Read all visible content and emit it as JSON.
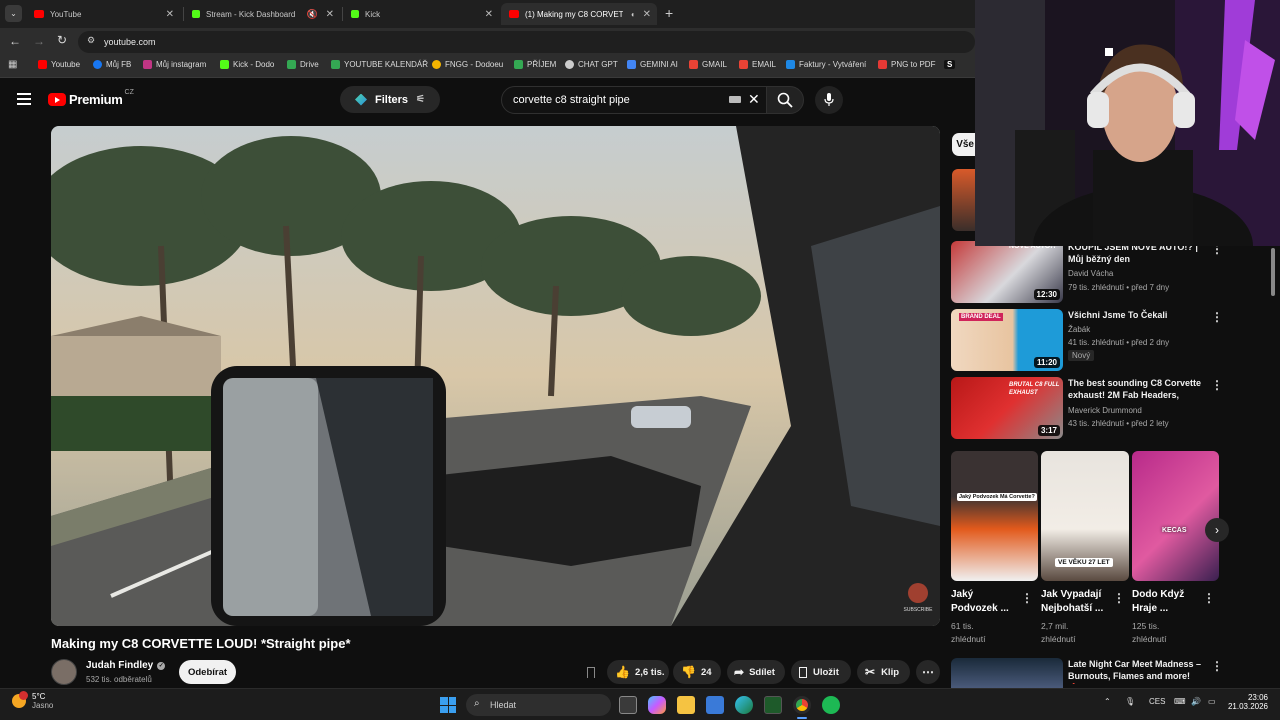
{
  "browser": {
    "tabs": [
      {
        "label": "YouTube",
        "color": "#ff0000"
      },
      {
        "label": "Stream - Kick Dashboard",
        "color": "#53fc18"
      },
      {
        "label": "Kick",
        "color": "#53fc18"
      },
      {
        "label": "(1) Making my C8 CORVETTE",
        "color": "#ff0000",
        "active": true
      }
    ],
    "url": "youtube.com",
    "bookmarks": [
      {
        "label": "Youtube",
        "color": "#ff0000"
      },
      {
        "label": "Můj FB",
        "color": "#1877f2"
      },
      {
        "label": "Můj instagram",
        "color": "#c13584"
      },
      {
        "label": "Kick - Dodo",
        "color": "#53fc18"
      },
      {
        "label": "Drive",
        "color": "#34a853"
      },
      {
        "label": "YOUTUBE KALENDÁŘ",
        "color": "#34a853"
      },
      {
        "label": "FNGG - Dodoeu",
        "color": "#f4b400"
      },
      {
        "label": "PŘÍJEM",
        "color": "#34a853"
      },
      {
        "label": "CHAT GPT",
        "color": "#cccccc"
      },
      {
        "label": "GEMINI AI",
        "color": "#4285f4"
      },
      {
        "label": "GMAIL",
        "color": "#ea4335"
      },
      {
        "label": "EMAIL",
        "color": "#ea4335"
      },
      {
        "label": "Faktury - Vytváření",
        "color": "#1e88e5"
      },
      {
        "label": "PNG to PDF",
        "color": "#e53935"
      },
      {
        "label": "S",
        "color": "#222222"
      }
    ]
  },
  "youtube": {
    "logo": "Premium",
    "region": "CZ",
    "filters_label": "Filters",
    "search_query": "corvette c8 straight pipe",
    "video": {
      "title": "Making my C8 CORVETTE LOUD! *Straight pipe*",
      "channel": "Judah Findley",
      "subscribers": "532 tis. odběratelů",
      "subscribe_label": "Odebírat",
      "likes": "2,6 tis.",
      "dislikes": "24",
      "share_label": "Sdílet",
      "save_label": "Uložit",
      "clip_label": "Klip",
      "watermark": "SUBSCRIBE"
    },
    "chip_label": "Vše",
    "recommendations": [
      {
        "title": "KOUPIL JSEM NOVÉ AUTO!? | Můj běžný den",
        "channel": "David Vácha",
        "meta": "79 tis. zhlédnutí • před 7 dny",
        "duration": "12:30",
        "thumb_text": "NOVÉ AUTO!?"
      },
      {
        "title": "Všichni Jsme To Čekali",
        "channel": "Žabák",
        "meta": "41 tis. zhlédnutí • před 2 dny",
        "badge": "Nový",
        "duration": "11:20",
        "thumb_text": "BRAND DEAL"
      },
      {
        "title": "The best sounding C8 Corvette exhaust! 2M Fab Headers, Cat...",
        "channel": "Maverick Drummond",
        "meta": "43 tis. zhlédnutí • před 2 lety",
        "duration": "3:17",
        "thumb_text": "BRUTAL C8 FULL EXHAUST"
      },
      {
        "title": "Late Night Car Meet Madness – Burnouts, Flames and more! 🔥",
        "channel": "",
        "meta": ""
      }
    ],
    "shorts": [
      {
        "title": "Jaký Podvozek ...",
        "views": "61 tis. zhlédnutí",
        "thumb_text": "Jaký Podvozek Má Corvette?"
      },
      {
        "title": "Jak Vypadají Nejbohatší ...",
        "views": "2,7 mil. zhlédnutí",
        "thumb_text": "VE VĚKU 27 LET"
      },
      {
        "title": "Dodo Když Hraje ...",
        "views": "125 tis. zhlédnutí",
        "thumb_text": "KECAS"
      }
    ]
  },
  "taskbar": {
    "weather_temp": "5°C",
    "weather_desc": "Jasno",
    "search_placeholder": "Hledat",
    "lang": "CES",
    "time": "23:06",
    "date": "21.03.2026"
  }
}
